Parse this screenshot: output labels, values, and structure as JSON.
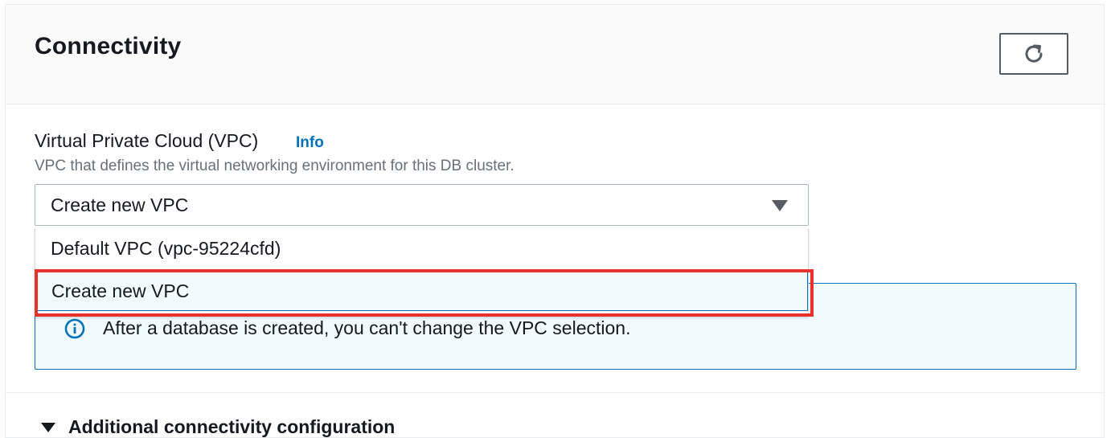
{
  "panel": {
    "title": "Connectivity",
    "refresh_icon": "refresh-icon"
  },
  "vpc": {
    "label": "Virtual Private Cloud (VPC)",
    "info_link": "Info",
    "description": "VPC that defines the virtual networking environment for this DB cluster.",
    "selected_value": "Create new VPC",
    "options": [
      {
        "label": "Default VPC (vpc-95224cfd)"
      },
      {
        "label": "Create new VPC"
      }
    ]
  },
  "alert": {
    "icon": "info-icon",
    "text": "After a database is created, you can't change the VPC selection."
  },
  "additional": {
    "label": "Additional connectivity configuration"
  },
  "colors": {
    "accent": "#0073bb",
    "highlight": "#e8322b",
    "alert_bg": "#f1faff"
  }
}
